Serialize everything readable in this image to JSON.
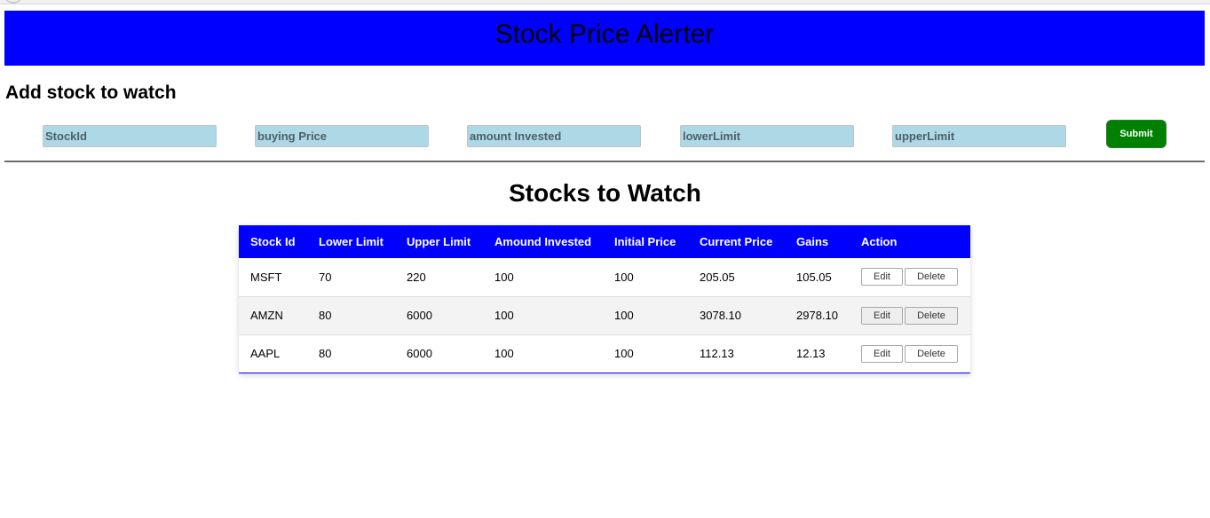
{
  "header": {
    "title": "Stock Price Alerter",
    "banner_color": "#0000ff"
  },
  "add_form": {
    "heading": "Add stock to watch",
    "fields": [
      {
        "name": "stock-id",
        "placeholder": "StockId",
        "value": ""
      },
      {
        "name": "buying-price",
        "placeholder": "buying Price",
        "value": ""
      },
      {
        "name": "amount-invested",
        "placeholder": "amount Invested",
        "value": ""
      },
      {
        "name": "lower-limit",
        "placeholder": "lowerLimit",
        "value": ""
      },
      {
        "name": "upper-limit",
        "placeholder": "upperLimit",
        "value": ""
      }
    ],
    "submit_label": "Submit",
    "input_color": "#add8e6",
    "submit_color": "#008000"
  },
  "watchlist": {
    "heading": "Stocks to Watch",
    "columns": [
      "Stock Id",
      "Lower Limit",
      "Upper Limit",
      "Amound Invested",
      "Initial Price",
      "Current Price",
      "Gains",
      "Action"
    ],
    "rows": [
      {
        "stock_id": "MSFT",
        "lower_limit": "70",
        "upper_limit": "220",
        "amount_invested": "100",
        "initial_price": "100",
        "current_price": "205.05",
        "gains": "105.05",
        "edit_label": "Edit",
        "delete_label": "Delete"
      },
      {
        "stock_id": "AMZN",
        "lower_limit": "80",
        "upper_limit": "6000",
        "amount_invested": "100",
        "initial_price": "100",
        "current_price": "3078.10",
        "gains": "2978.10",
        "edit_label": "Edit",
        "delete_label": "Delete"
      },
      {
        "stock_id": "AAPL",
        "lower_limit": "80",
        "upper_limit": "6000",
        "amount_invested": "100",
        "initial_price": "100",
        "current_price": "112.13",
        "gains": "12.13",
        "edit_label": "Edit",
        "delete_label": "Delete"
      }
    ],
    "header_color": "#0000ff"
  }
}
